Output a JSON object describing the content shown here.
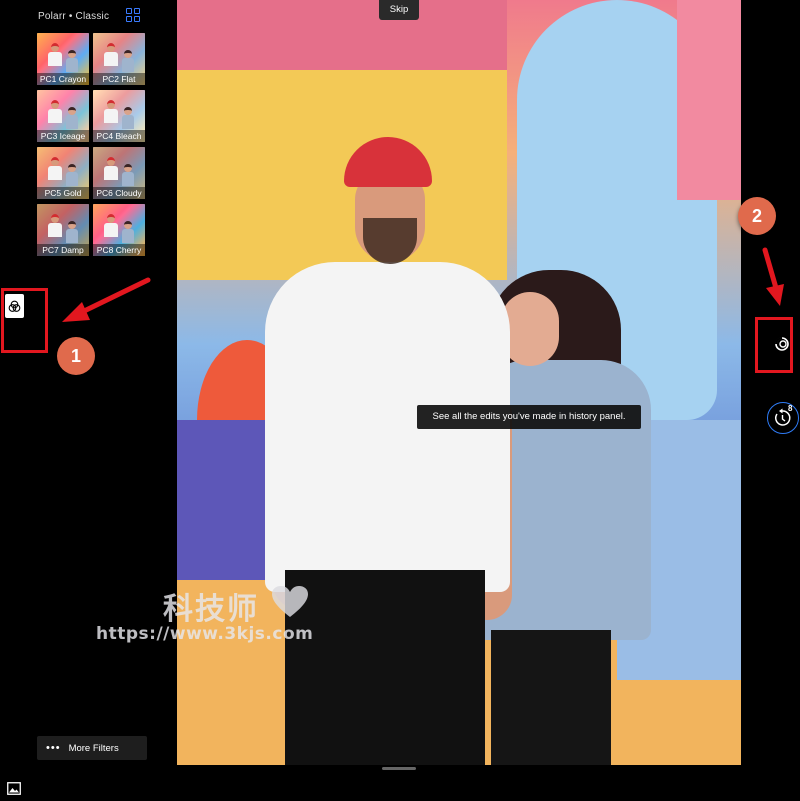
{
  "sidebar": {
    "collection_title": "Polarr • Classic",
    "filters": [
      {
        "label": "PC1 Crayon"
      },
      {
        "label": "PC2 Flat"
      },
      {
        "label": "PC3 Iceage"
      },
      {
        "label": "PC4 Bleach"
      },
      {
        "label": "PC5 Gold"
      },
      {
        "label": "PC6 Cloudy"
      },
      {
        "label": "PC7 Damp"
      },
      {
        "label": "PC8 Cherry"
      }
    ],
    "more_filters_label": "More Filters"
  },
  "toolbar": {
    "skip_label": "Skip"
  },
  "tooltip": {
    "text": "See all the edits you've made in history panel."
  },
  "history": {
    "count": "8"
  },
  "annotations": {
    "badge_1": "1",
    "badge_2": "2"
  },
  "watermark": {
    "text_cn": "科技师",
    "url": "https://www.3kjs.com"
  },
  "colors": {
    "accent": "#2f7cf6",
    "annotation_red": "#e2171f",
    "badge_orange": "#e06a4c"
  }
}
